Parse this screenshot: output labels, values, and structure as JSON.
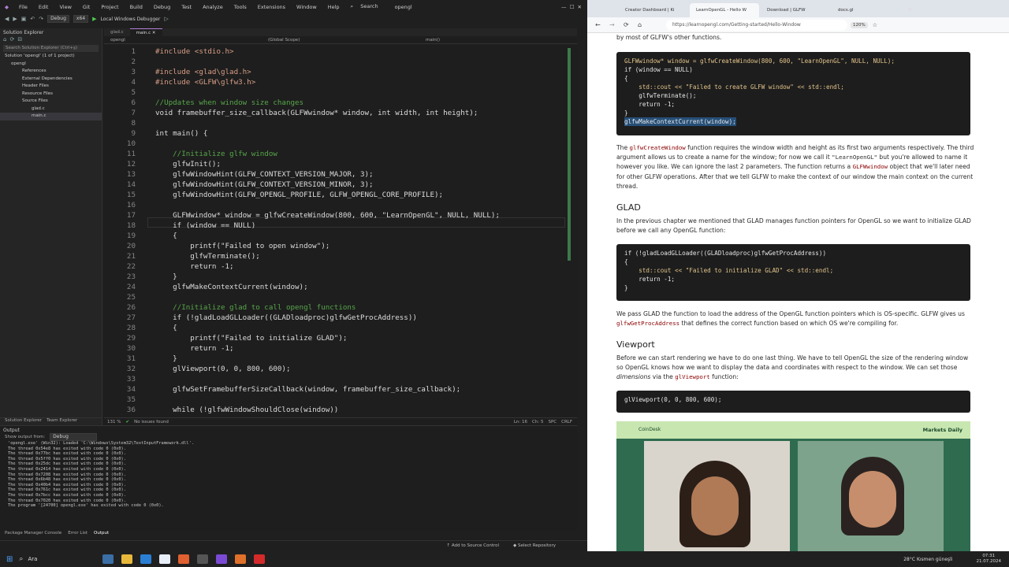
{
  "vs": {
    "menu": [
      "File",
      "Edit",
      "View",
      "Git",
      "Project",
      "Build",
      "Debug",
      "Test",
      "Analyze",
      "Tools",
      "Extensions",
      "Window",
      "Help",
      "Search",
      "opengl"
    ],
    "toolbar": {
      "config": "Debug",
      "platform": "x64",
      "debugger": "Local Windows Debugger"
    },
    "solution_explorer": {
      "title": "Solution Explorer",
      "search": "Search Solution Explorer (Ctrl+ş)",
      "items": [
        "Solution 'opengl' (1 of 1 project)",
        "opengl",
        "References",
        "External Dependencies",
        "Header Files",
        "Resource Files",
        "Source Files",
        "glad.c",
        "main.c"
      ],
      "tabs": [
        "Solution Explorer",
        "Team Explorer"
      ]
    },
    "editor": {
      "tabs": [
        "glad.c",
        "main.c"
      ],
      "nav": [
        "opengl",
        "(Global Scope)",
        "main()"
      ],
      "lines": [
        {
          "n": "1",
          "t": "#include <stdio.h>"
        },
        {
          "n": "2",
          "t": ""
        },
        {
          "n": "3",
          "t": "#include <glad\\glad.h>"
        },
        {
          "n": "4",
          "t": "#include <GLFW\\glfw3.h>"
        },
        {
          "n": "5",
          "t": ""
        },
        {
          "n": "6",
          "t": "//Updates when window size changes"
        },
        {
          "n": "7",
          "t": "void framebuffer_size_callback(GLFWwindow* window, int width, int height);"
        },
        {
          "n": "8",
          "t": ""
        },
        {
          "n": "9",
          "t": "int main() {"
        },
        {
          "n": "10",
          "t": ""
        },
        {
          "n": "11",
          "t": "    //Initialize glfw window"
        },
        {
          "n": "12",
          "t": "    glfwInit();"
        },
        {
          "n": "13",
          "t": "    glfwWindowHint(GLFW_CONTEXT_VERSION_MAJOR, 3);"
        },
        {
          "n": "14",
          "t": "    glfwWindowHint(GLFW_CONTEXT_VERSION_MINOR, 3);"
        },
        {
          "n": "15",
          "t": "    glfwWindowHint(GLFW_OPENGL_PROFILE, GLFW_OPENGL_CORE_PROFILE);"
        },
        {
          "n": "16",
          "t": ""
        },
        {
          "n": "17",
          "t": "    GLFWwindow* window = glfwCreateWindow(800, 600, \"LearnOpenGL\", NULL, NULL);"
        },
        {
          "n": "18",
          "t": "    if (window == NULL)"
        },
        {
          "n": "19",
          "t": "    {"
        },
        {
          "n": "20",
          "t": "        printf(\"Failed to open window\");"
        },
        {
          "n": "21",
          "t": "        glfwTerminate();"
        },
        {
          "n": "22",
          "t": "        return -1;"
        },
        {
          "n": "23",
          "t": "    }"
        },
        {
          "n": "24",
          "t": "    glfwMakeContextCurrent(window);"
        },
        {
          "n": "25",
          "t": ""
        },
        {
          "n": "26",
          "t": "    //Initialize glad to call opengl functions"
        },
        {
          "n": "27",
          "t": "    if (!gladLoadGLLoader((GLADloadproc)glfwGetProcAddress))"
        },
        {
          "n": "28",
          "t": "    {"
        },
        {
          "n": "29",
          "t": "        printf(\"Failed to initialize GLAD\");"
        },
        {
          "n": "30",
          "t": "        return -1;"
        },
        {
          "n": "31",
          "t": "    }"
        },
        {
          "n": "32",
          "t": "    glViewport(0, 0, 800, 600);"
        },
        {
          "n": "33",
          "t": ""
        },
        {
          "n": "34",
          "t": "    glfwSetFramebufferSizeCallback(window, framebuffer_size_callback);"
        },
        {
          "n": "35",
          "t": ""
        },
        {
          "n": "36",
          "t": "    while (!glfwWindowShouldClose(window))"
        }
      ],
      "status": {
        "zoom": "131 %",
        "issues": "No issues found",
        "ln": "Ln: 16",
        "ch": "Ch: 5",
        "spc": "SPC",
        "crlf": "CRLF"
      }
    },
    "output": {
      "title": "Output",
      "show_from_label": "Show output from:",
      "show_from": "Debug",
      "lines": [
        "'opengl.exe' (Win32): Loaded 'C:\\Windows\\System32\\TextInputFramework.dll'.",
        "The thread 0x54e8 has exited with code 0 (0x0).",
        "The thread 0x77bc has exited with code 0 (0x0).",
        "The thread 0x5ff0 has exited with code 0 (0x0).",
        "The thread 0x25dc has exited with code 0 (0x0).",
        "The thread 0x2414 has exited with code 0 (0x0).",
        "The thread 0x7208 has exited with code 0 (0x0).",
        "The thread 0x6b48 has exited with code 0 (0x0).",
        "The thread 0x40b4 has exited with code 0 (0x0).",
        "The thread 0x761c has exited with code 0 (0x0).",
        "The thread 0x7bcc has exited with code 0 (0x0).",
        "The thread 0x7020 has exited with code 0 (0x0).",
        "The program '[24700] opengl.exe' has exited with code 0 (0x0)."
      ],
      "tabs": [
        "Package Manager Console",
        "Error List",
        "Output"
      ]
    },
    "statusbar": {
      "source": "Add to Source Control",
      "repo": "Select Repository"
    }
  },
  "browser": {
    "tabs": [
      "Creator Dashboard | Ki",
      "LearnOpenGL - Hello W",
      "Download | GLFW",
      "docs.gl"
    ],
    "url": "https://learnopengl.com/Getting-started/Hello-Window",
    "zoom": "120%",
    "intro_tail": "by most of GLFW's other functions.",
    "code1": [
      "GLFWwindow* window = glfwCreateWindow(800, 600, \"LearnOpenGL\", NULL, NULL);",
      "if (window == NULL)",
      "{",
      "    std::cout << \"Failed to create GLFW window\" << std::endl;",
      "    glfwTerminate();",
      "    return -1;",
      "}",
      "glfwMakeContextCurrent(window);"
    ],
    "para1": {
      "a": "The ",
      "fn1": "glfwCreateWindow",
      "b": " function requires the window width and height as its first two arguments respectively. The third argument allows us to create a name for the window; for now we call it ",
      "c": "\"LearnOpenGL\"",
      "d": " but you're allowed to name it however you like. We can ignore the last 2 parameters. The function returns a ",
      "fn2": "GLFWwindow",
      "e": " object that we'll later need for other GLFW operations. After that we tell GLFW to make the context of our window the main context on the current thread."
    },
    "h_glad": "GLAD",
    "para2": "In the previous chapter we mentioned that GLAD manages function pointers for OpenGL so we want to initialize GLAD before we call any OpenGL function:",
    "code2": [
      "if (!gladLoadGLLoader((GLADloadproc)glfwGetProcAddress))",
      "{",
      "    std::cout << \"Failed to initialize GLAD\" << std::endl;",
      "    return -1;",
      "}"
    ],
    "para3": {
      "a": "We pass GLAD the function to load the address of the OpenGL function pointers which is OS-specific. GLFW gives us ",
      "fn": "glfwGetProcAddress",
      "b": " that defines the correct function based on which OS we're compiling for."
    },
    "h_viewport": "Viewport",
    "para4": {
      "a": "Before we can start rendering we have to do one last thing. We have to tell OpenGL the size of the rendering window so OpenGL knows how we want to display the data and coordinates with respect to the window. We can set those ",
      "em": "dimensions",
      "b": " via the ",
      "fn": "glViewport",
      "c": " function:"
    },
    "code3": "glViewport(0, 0, 800, 600);",
    "video": {
      "left": "CoinDesk",
      "right": "Markets Daily"
    }
  },
  "taskbar": {
    "search": "Ara",
    "weather": "28°C  Kısmen güneşli",
    "time": "07:31",
    "date": "21.07.2024"
  }
}
